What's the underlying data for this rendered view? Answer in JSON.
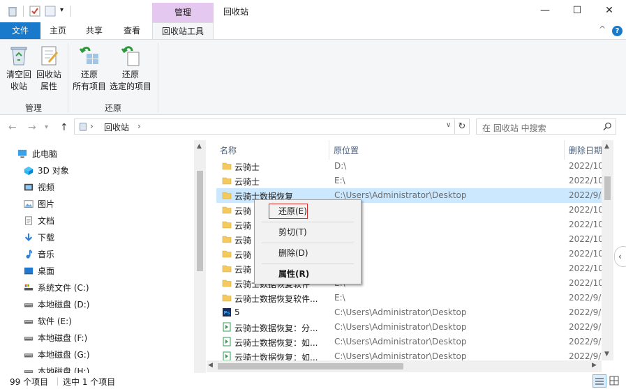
{
  "titlebar": {
    "context_tab_header": "管理",
    "window_title": "回收站",
    "minimize": "—",
    "maximize": "☐",
    "close": "✕"
  },
  "tabs": {
    "file": "文件",
    "home": "主页",
    "share": "共享",
    "view": "查看",
    "recycle_tools": "回收站工具",
    "collapse": "^",
    "help": "?"
  },
  "ribbon": {
    "empty_line1": "清空回",
    "empty_line2": "收站",
    "props_line1": "回收站",
    "props_line2": "属性",
    "restore_all_line1": "还原",
    "restore_all_line2": "所有项目",
    "restore_sel_line1": "还原",
    "restore_sel_line2": "选定的项目",
    "group_manage": "管理",
    "group_restore": "还原"
  },
  "address": {
    "breadcrumb_root": "回收站",
    "search_placeholder": "在 回收站 中搜索"
  },
  "nav": [
    {
      "label": "此电脑",
      "icon": "pc-icon"
    },
    {
      "label": "3D 对象",
      "icon": "3d-icon"
    },
    {
      "label": "视频",
      "icon": "video-icon"
    },
    {
      "label": "图片",
      "icon": "pictures-icon"
    },
    {
      "label": "文档",
      "icon": "documents-icon"
    },
    {
      "label": "下载",
      "icon": "download-icon"
    },
    {
      "label": "音乐",
      "icon": "music-icon"
    },
    {
      "label": "桌面",
      "icon": "desktop-icon"
    },
    {
      "label": "系统文件 (C:)",
      "icon": "system-drive-icon"
    },
    {
      "label": "本地磁盘 (D:)",
      "icon": "drive-icon"
    },
    {
      "label": "软件 (E:)",
      "icon": "drive-icon"
    },
    {
      "label": "本地磁盘 (F:)",
      "icon": "drive-icon"
    },
    {
      "label": "本地磁盘 (G:)",
      "icon": "drive-icon"
    },
    {
      "label": "本地磁盘 (H:)",
      "icon": "drive-icon"
    }
  ],
  "columns": {
    "name": "名称",
    "location": "原位置",
    "date": "删除日期"
  },
  "files": [
    {
      "name": "云骑士",
      "location": "D:\\",
      "date": "2022/10",
      "icon": "folder"
    },
    {
      "name": "云骑士",
      "location": "E:\\",
      "date": "2022/10",
      "icon": "folder"
    },
    {
      "name": "云骑士数据恢复",
      "location": "C:\\Users\\Administrator\\Desktop",
      "date": "2022/9/",
      "icon": "folder"
    },
    {
      "name": "云骑",
      "location": "",
      "date": "2022/10",
      "icon": "folder"
    },
    {
      "name": "云骑",
      "location": "",
      "date": "2022/10",
      "icon": "folder"
    },
    {
      "name": "云骑",
      "location": "",
      "date": "2022/10",
      "icon": "folder"
    },
    {
      "name": "云骑",
      "location": "",
      "date": "2022/10",
      "icon": "folder"
    },
    {
      "name": "云骑",
      "location": "",
      "date": "2022/10",
      "icon": "folder"
    },
    {
      "name": "云骑士数据恢复软件",
      "location": "E:\\",
      "date": "2022/10",
      "icon": "folder"
    },
    {
      "name": "云骑士数据恢复软件...",
      "location": "E:\\",
      "date": "2022/9/",
      "icon": "folder"
    },
    {
      "name": "5",
      "location": "C:\\Users\\Administrator\\Desktop",
      "date": "2022/9/",
      "icon": "ps"
    },
    {
      "name": "云骑士数据恢复：分...",
      "location": "C:\\Users\\Administrator\\Desktop",
      "date": "2022/9/",
      "icon": "doc"
    },
    {
      "name": "云骑士数据恢复：如...",
      "location": "C:\\Users\\Administrator\\Desktop",
      "date": "2022/9/",
      "icon": "doc"
    },
    {
      "name": "云骑士数据恢复：如...",
      "location": "C:\\Users\\Administrator\\Desktop",
      "date": "2022/9/",
      "icon": "doc"
    }
  ],
  "context_menu": {
    "restore": "还原(E)",
    "cut": "剪切(T)",
    "delete": "删除(D)",
    "properties": "属性(R)"
  },
  "status": {
    "count": "99 个项目",
    "selected": "选中 1 个项目"
  },
  "colors": {
    "accent": "#1979ca",
    "context_tab": "#e5c8ef",
    "selection": "#cce8ff",
    "folder": "#f4c95d"
  }
}
